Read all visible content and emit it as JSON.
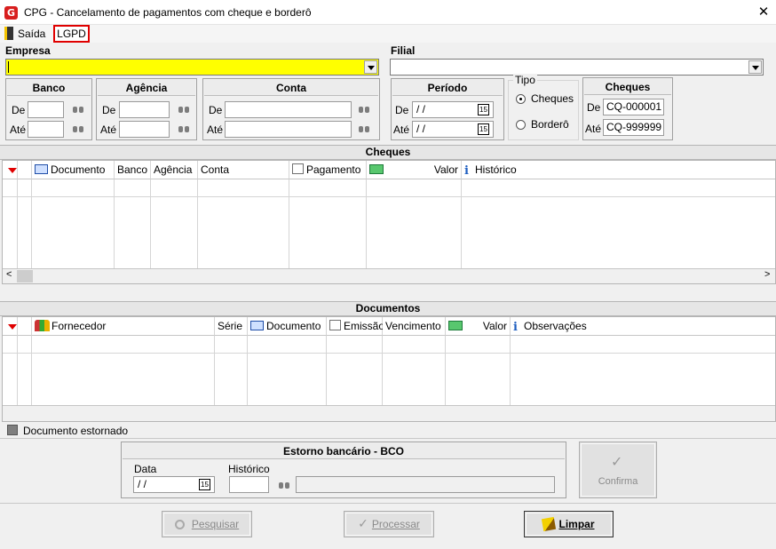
{
  "window": {
    "title": "CPG - Cancelamento de pagamentos com cheque e borderô",
    "close_glyph": "✕"
  },
  "menu": {
    "saida": "Saída",
    "lgpd": "LGPD"
  },
  "filters": {
    "empresa_label": "Empresa",
    "filial_label": "Filial",
    "empresa_value": "",
    "filial_value": "",
    "banco": {
      "title": "Banco",
      "de": "De",
      "ate": "Até"
    },
    "agencia": {
      "title": "Agência",
      "de": "De",
      "ate": "Até"
    },
    "conta": {
      "title": "Conta",
      "de": "De",
      "ate": "Até"
    },
    "periodo": {
      "title": "Período",
      "de": "De",
      "ate": "Até",
      "de_value": " /  /",
      "ate_value": " /  /"
    },
    "tipo": {
      "title": "Tipo",
      "cheques": "Cheques",
      "bordero": "Borderô",
      "selected": "cheques"
    },
    "cheques": {
      "title": "Cheques",
      "de": "De",
      "ate": "Até",
      "de_value": "CQ-000001",
      "ate_value": "CQ-999999"
    }
  },
  "cheques_grid": {
    "title": "Cheques",
    "columns": [
      "Documento",
      "Banco",
      "Agência",
      "Conta",
      "Pagamento",
      "Valor",
      "Histórico"
    ]
  },
  "documentos_grid": {
    "title": "Documentos",
    "columns": [
      "Fornecedor",
      "Série",
      "Documento",
      "Emissão",
      "Vencimento",
      "Valor",
      "Observações"
    ]
  },
  "legend": {
    "text": "Documento estornado",
    "color": "#7f7f7f"
  },
  "estorno": {
    "title": "Estorno bancário - BCO",
    "data_label": "Data",
    "data_value": " /  /",
    "historico_label": "Histórico",
    "confirma_label": "Confirma"
  },
  "actions": {
    "pesquisar": "Pesquisar",
    "processar": "Processar",
    "limpar": "Limpar"
  },
  "icons": {
    "calendar_glyph": "15",
    "app_glyph": "G",
    "check_glyph": "✓",
    "scroll_left": "<",
    "scroll_right": ">"
  }
}
